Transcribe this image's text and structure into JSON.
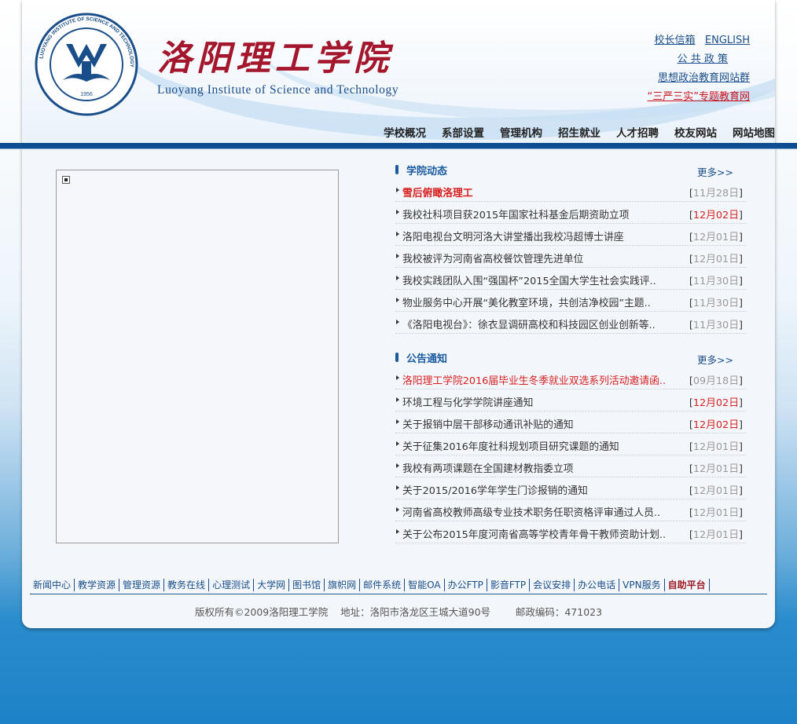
{
  "header": {
    "brand_cn": "洛阳理工学院",
    "brand_en": "Luoyang Institute of Science and Technology",
    "logo_year": "1956",
    "logo_ring_text": "LUOYANG INSTITUTE OF SCIENCE AND TECHNOLOGY",
    "top_links": {
      "mailbox": "校长信箱",
      "english": "ENGLISH",
      "policy": "公 共 政 策",
      "politics": "思想政治教育网站群",
      "sanyan": "“三严三实”专题教育网"
    },
    "nav": [
      "学校概况",
      "系部设置",
      "管理机构",
      "招生就业",
      "人才招聘",
      "校友网站",
      "网站地图"
    ]
  },
  "news": {
    "title": "学院动态",
    "more": "更多>>",
    "items": [
      {
        "title": "雪后俯瞰洛理工",
        "date": "11月28日",
        "red_title": true,
        "bold": true,
        "red_date": false
      },
      {
        "title": "我校社科项目获2015年国家社科基金后期资助立项",
        "date": "12月02日",
        "red_title": false,
        "bold": false,
        "red_date": true
      },
      {
        "title": "洛阳电视台文明河洛大讲堂播出我校冯超博士讲座",
        "date": "12月01日",
        "red_title": false,
        "bold": false,
        "red_date": false
      },
      {
        "title": "我校被评为河南省高校餐饮管理先进单位",
        "date": "12月01日",
        "red_title": false,
        "bold": false,
        "red_date": false
      },
      {
        "title": "我校实践团队入围“强国杯”2015全国大学生社会实践评..",
        "date": "11月30日",
        "red_title": false,
        "bold": false,
        "red_date": false
      },
      {
        "title": "物业服务中心开展“美化教室环境，共创洁净校园”主题..",
        "date": "11月30日",
        "red_title": false,
        "bold": false,
        "red_date": false
      },
      {
        "title": "《洛阳电视台》：徐衣显调研高校和科技园区创业创新等..",
        "date": "11月30日",
        "red_title": false,
        "bold": false,
        "red_date": false
      }
    ]
  },
  "notices": {
    "title": "公告通知",
    "more": "更多>>",
    "items": [
      {
        "title": "洛阳理工学院2016届毕业生冬季就业双选系列活动邀请函..",
        "date": "09月18日",
        "red_title": true,
        "bold": false,
        "red_date": false
      },
      {
        "title": "环境工程与化学学院讲座通知",
        "date": "12月02日",
        "red_title": false,
        "bold": false,
        "red_date": true
      },
      {
        "title": "关于报销中层干部移动通讯补贴的通知",
        "date": "12月02日",
        "red_title": false,
        "bold": false,
        "red_date": true
      },
      {
        "title": "关于征集2016年度社科规划项目研究课题的通知",
        "date": "12月01日",
        "red_title": false,
        "bold": false,
        "red_date": false
      },
      {
        "title": "我校有两项课题在全国建材教指委立项",
        "date": "12月01日",
        "red_title": false,
        "bold": false,
        "red_date": false
      },
      {
        "title": "关于2015/2016学年学生门诊报销的通知",
        "date": "12月01日",
        "red_title": false,
        "bold": false,
        "red_date": false
      },
      {
        "title": "河南省高校教师高级专业技术职务任职资格评审通过人员..",
        "date": "12月01日",
        "red_title": false,
        "bold": false,
        "red_date": false
      },
      {
        "title": "关于公布2015年度河南省高等学校青年骨干教师资助计划..",
        "date": "12月01日",
        "red_title": false,
        "bold": false,
        "red_date": false
      }
    ]
  },
  "footer": {
    "links": [
      "新闻中心",
      "教学资源",
      "管理资源",
      "教务在线",
      "心理测试",
      "大学网",
      "图书馆",
      "旗帜网",
      "邮件系统",
      "智能OA",
      "办公FTP",
      "影音FTP",
      "会议安排",
      "办公电话",
      "VPN服务",
      "自助平台"
    ],
    "special_link": "自助平台",
    "copyright": "版权所有©2009洛阳理工学院    地址：洛阳市洛龙区王城大道90号        邮政编码：471023"
  },
  "colors": {
    "brand_red": "#a3162b",
    "brand_blue": "#1a4e8a",
    "nav_bar": "#0d4d92",
    "alert_red": "#d81e1e"
  }
}
